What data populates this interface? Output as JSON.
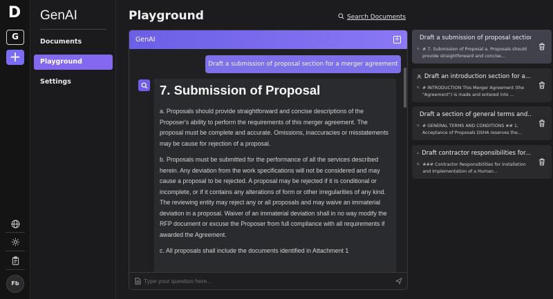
{
  "rail": {
    "logo": "D",
    "workspace_initial": "G",
    "add_symbol": "+",
    "avatar": "Fb"
  },
  "nav": {
    "title": "GenAI",
    "items": [
      {
        "label": "Documents",
        "active": false
      },
      {
        "label": "Playground",
        "active": true
      },
      {
        "label": "Settings",
        "active": false
      }
    ]
  },
  "main": {
    "title": "Playground",
    "search_label": "Search Documents"
  },
  "chat": {
    "header": "GenAI",
    "user_message": "Draft a submission of proposal section for a merger agreement",
    "answer_heading": "7. Submission of Proposal",
    "answer_paragraphs": [
      "a. Proposals should provide straightforward and concise descriptions of the Proposer's ability to perform the requirements of this merger agreement. The proposal must be complete and accurate. Omissions, inaccuracies or misstatements may be cause for rejection of a proposal.",
      "b. Proposals must be submitted for the performance of all the services described herein. Any deviation from the work specifications will not be considered and may cause a proposal to be rejected. A proposal may be rejected if it is conditional or incomplete, or if it contains any alterations of form or other irregularities of any kind. The reviewing entity may reject any or all proposals and may waive an immaterial deviation in a proposal. Waiver of an immaterial deviation shall in no way modify the RFP document or excuse the Proposer from full compliance with all requirements if awarded the Agreement.",
      "c. All proposals shall include the documents identified in Attachment 1"
    ],
    "input_placeholder": "Type your question here..."
  },
  "history": [
    {
      "title": "Draft a submission of proposal section...",
      "snippet": "# 7. Submission of Proposal a. Proposals should provide straightforward and concise...",
      "active": true
    },
    {
      "title": "Draft an introduction section for a...",
      "snippet": "# INTRODUCTION This Merger Agreement (the \"Agreement\") is made and entered into ...",
      "active": false
    },
    {
      "title": "Draft a section of general terms and...",
      "snippet": "# GENERAL TERMS AND CONDITIONS ## 1. Acceptance of Proposals DSHA reserves the...",
      "active": false
    },
    {
      "title": "Draft contractor responsibilities for...",
      "snippet": "### Contractor Responsibilities for Installation and Implementation of a Human...",
      "active": false
    }
  ],
  "colors": {
    "accent": "#8468f0",
    "user_bubble": "#7c71e8",
    "background": "#1c1c1e"
  }
}
